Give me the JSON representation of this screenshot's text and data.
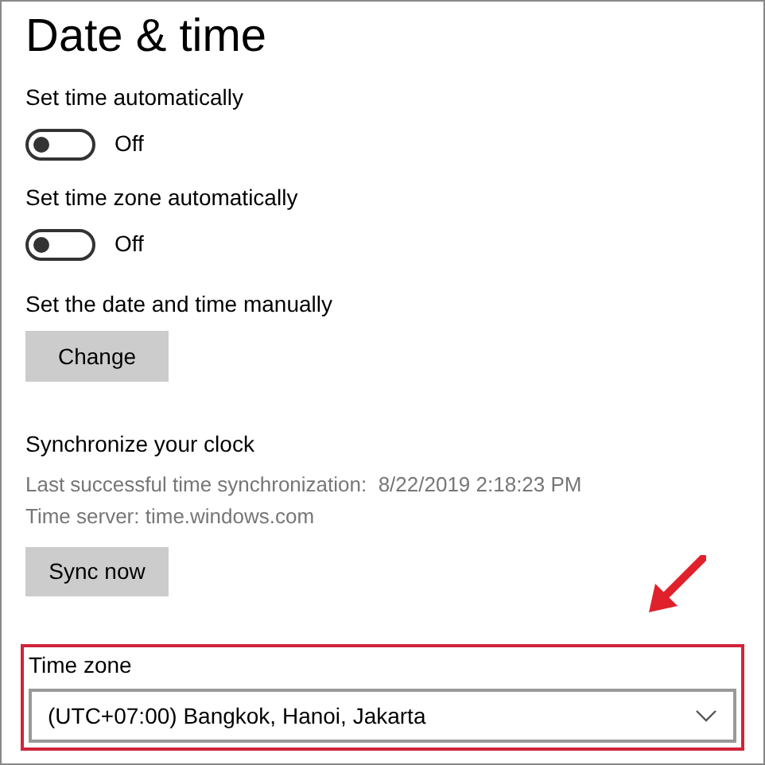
{
  "title": "Date & time",
  "toggles": [
    {
      "label": "Set time automatically",
      "on": false,
      "state_text": "Off"
    },
    {
      "label": "Set time zone automatically",
      "on": false,
      "state_text": "Off"
    }
  ],
  "manual": {
    "label": "Set the date and time manually",
    "button": "Change"
  },
  "sync": {
    "heading": "Synchronize your clock",
    "last_sync": "Last successful time synchronization:  8/22/2019 2:18:23 PM",
    "server": "Time server: time.windows.com",
    "button": "Sync now"
  },
  "time_zone": {
    "label": "Time zone",
    "value": "(UTC+07:00) Bangkok, Hanoi, Jakarta"
  }
}
